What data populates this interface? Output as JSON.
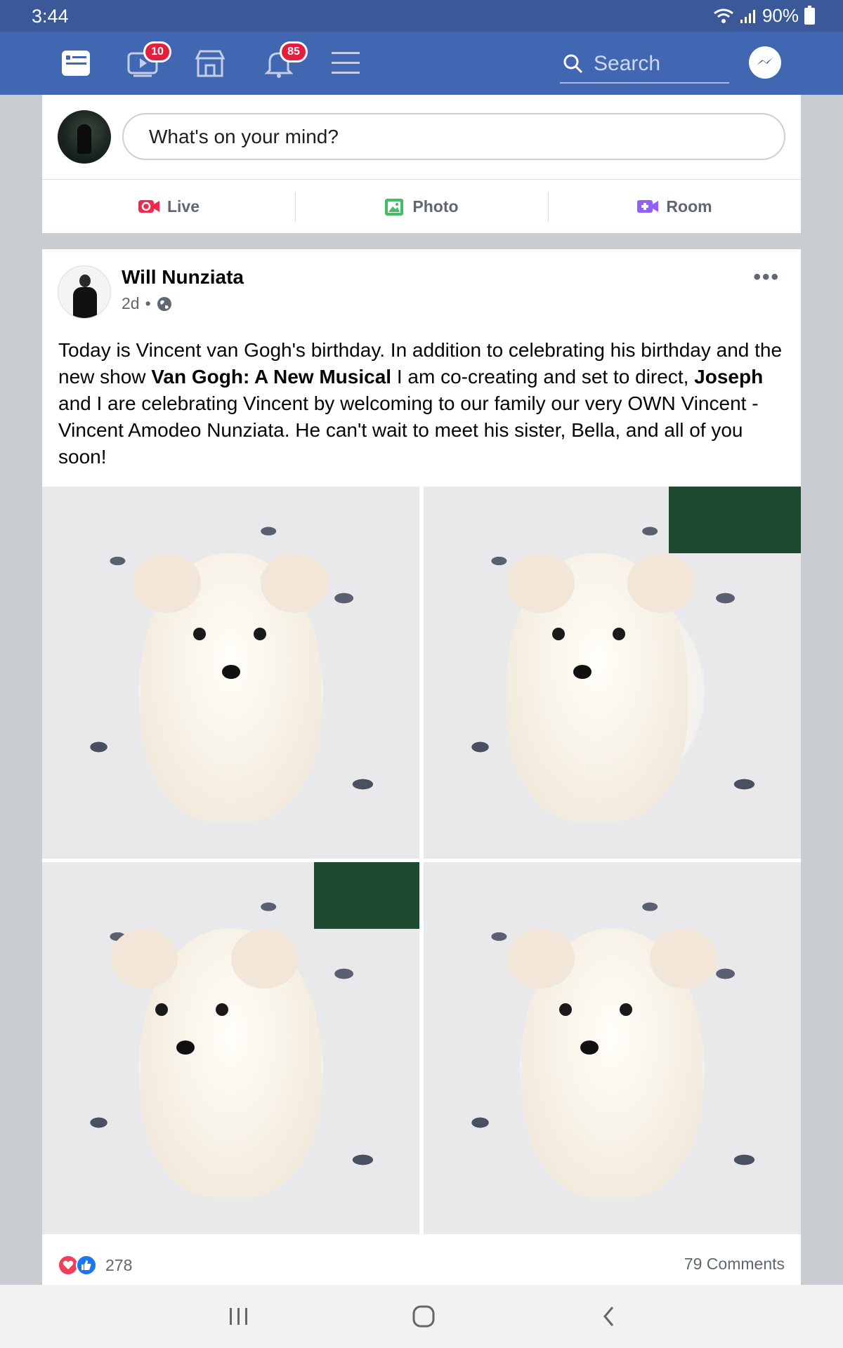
{
  "status_bar": {
    "time": "3:44",
    "battery": "90%"
  },
  "topnav": {
    "video_badge": "10",
    "notifications_badge": "85",
    "search_placeholder": "Search"
  },
  "composer": {
    "prompt": "What's on your mind?",
    "actions": [
      {
        "label": "Live",
        "icon": "live-video-icon",
        "color": "#f02849"
      },
      {
        "label": "Photo",
        "icon": "photo-icon",
        "color": "#45bd62"
      },
      {
        "label": "Room",
        "icon": "room-video-icon",
        "color": "#9360f7"
      }
    ]
  },
  "post": {
    "author": "Will Nunziata",
    "time": "2d",
    "privacy_icon": "globe-icon",
    "text_parts": [
      "Today is Vincent van Gogh's birthday. In addition to celebrating his birthday and the new show ",
      "Van Gogh: A New Musical",
      " I am co-creating and set to direct, ",
      "Joseph",
      " and I are celebrating Vincent by welcoming to our family our very OWN Vincent - Vincent Amodeo Nunziata. He can't wait to meet his sister, Bella, and all of you soon!"
    ],
    "photos_count": 4,
    "reaction_count": "278",
    "comments": "79 Comments"
  },
  "colors": {
    "brand": "#4267b2",
    "status_bar": "#3b5998",
    "badge": "#e41e3f"
  }
}
